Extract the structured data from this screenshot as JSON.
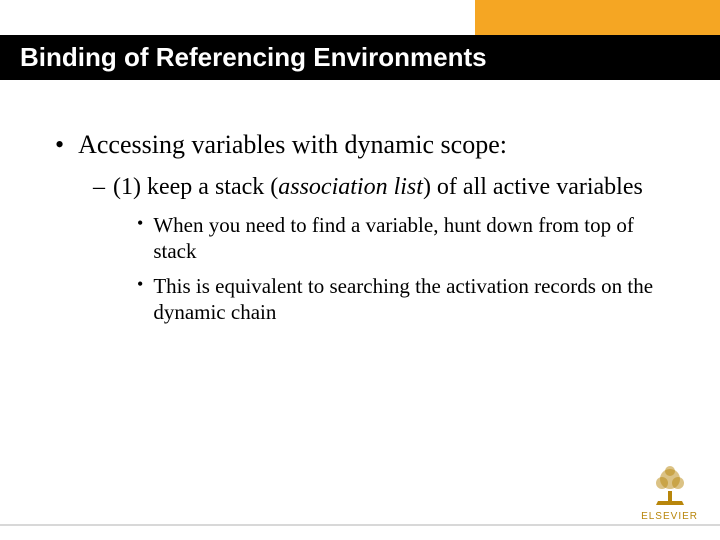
{
  "title": "Binding of Referencing Environments",
  "bullets": {
    "l1": "Accessing variables with dynamic scope:",
    "l2_prefix": "(1) keep a stack (",
    "l2_italic": "association list",
    "l2_suffix": ") of all active variables",
    "l3a": "When you need to find a variable, hunt down from top of stack",
    "l3b": "This is equivalent to searching the activation records on the dynamic chain"
  },
  "logo": {
    "text": "ELSEVIER"
  }
}
